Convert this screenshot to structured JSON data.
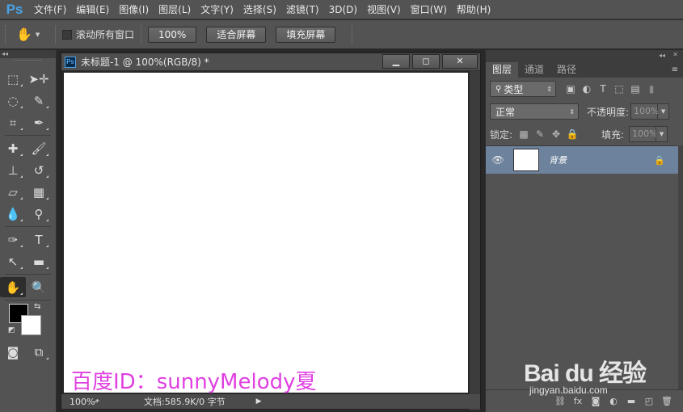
{
  "app": {
    "logo": "Ps"
  },
  "menu": [
    "文件(F)",
    "编辑(E)",
    "图像(I)",
    "图层(L)",
    "文字(Y)",
    "选择(S)",
    "滤镜(T)",
    "3D(D)",
    "视图(V)",
    "窗口(W)",
    "帮助(H)"
  ],
  "options": {
    "tool_icon": "hand-icon",
    "scroll_all_label": "滚动所有窗口",
    "zoom_100": "100%",
    "fit_screen": "适合屏幕",
    "fill_screen": "填充屏幕"
  },
  "document": {
    "title": "未标题-1 @ 100%(RGB/8) *",
    "ps_icon": "Ps",
    "status_zoom": "100%",
    "status_doc": "文档:585.9K/0 字节"
  },
  "panel": {
    "tabs": [
      "图层",
      "通道",
      "路径"
    ],
    "filter_type": "类型",
    "blend_mode": "正常",
    "opacity_label": "不透明度:",
    "opacity_value": "100%",
    "lock_label": "锁定:",
    "fill_label": "填充:",
    "fill_value": "100%",
    "layer_name": "背景"
  },
  "watermark": {
    "text": "百度ID：sunnyMelody夏",
    "brand": "Bai du 经验",
    "url": "jingyan.baidu.com"
  },
  "colors": {
    "foreground": "#000000",
    "background": "#ffffff",
    "selected_layer": "#6d829c",
    "watermark": "#e040e0"
  }
}
